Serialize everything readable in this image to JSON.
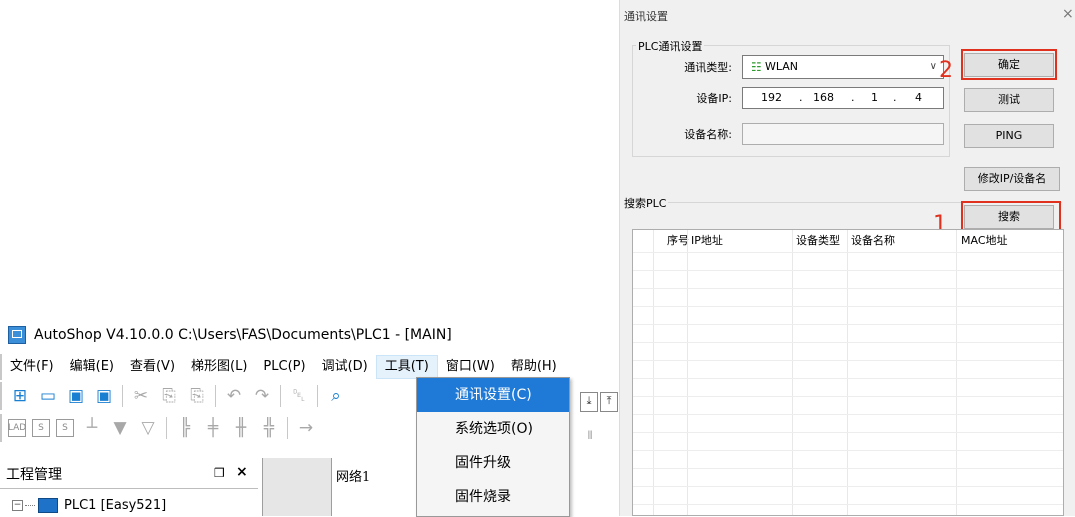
{
  "app": {
    "title": "AutoShop V4.10.0.0  C:\\Users\\FAS\\Documents\\PLC1 - [MAIN]"
  },
  "menubar": {
    "items": [
      "文件(F)",
      "编辑(E)",
      "查看(V)",
      "梯形图(L)",
      "PLC(P)",
      "调试(D)",
      "工具(T)",
      "窗口(W)",
      "帮助(H)"
    ]
  },
  "toolbar1": {
    "icons": [
      "new-file-icon",
      "open-folder-icon",
      "save-icon",
      "save-all-icon",
      "cut-icon",
      "copy-icon",
      "paste-icon",
      "undo-icon",
      "redo-icon",
      "delete-icon",
      "search-icon"
    ]
  },
  "toolbar2": {
    "icons": [
      "lad-icon",
      "s-box-icon",
      "s-box2-icon",
      "contact-icon",
      "coil-down-icon",
      "coil-outline-icon",
      "rung-icon",
      "rung2-icon",
      "rung3-icon",
      "rung4-icon",
      "arrow-right-icon"
    ]
  },
  "tools_menu": {
    "items": [
      "通讯设置(C)",
      "系统选项(O)",
      "固件升级",
      "固件烧录"
    ],
    "selected_index": 0
  },
  "project_panel": {
    "title": "工程管理",
    "pin": "❒",
    "close": "×",
    "tree_root": "PLC1 [Easy521]"
  },
  "editor": {
    "network_label": "网络1"
  },
  "dialog": {
    "title": "通讯设置",
    "close": "×",
    "plc_group_label": "PLC通讯设置",
    "comm_type_label": "通讯类型:",
    "comm_type_value": "WLAN",
    "device_ip_label": "设备IP:",
    "ip": [
      "192",
      "168",
      "1",
      "4"
    ],
    "device_name_label": "设备名称:",
    "device_name_value": "",
    "ok_button": "确定",
    "test_button": "测试",
    "ping_button": "PING",
    "modify_button": "修改IP/设备名",
    "search_group_label": "搜索PLC",
    "search_button": "搜索",
    "annotation_1": "1",
    "annotation_2": "2",
    "table_headers": [
      "序号",
      "IP地址",
      "设备类型",
      "设备名称",
      "MAC地址"
    ],
    "highlight_color": "#e0301e"
  }
}
